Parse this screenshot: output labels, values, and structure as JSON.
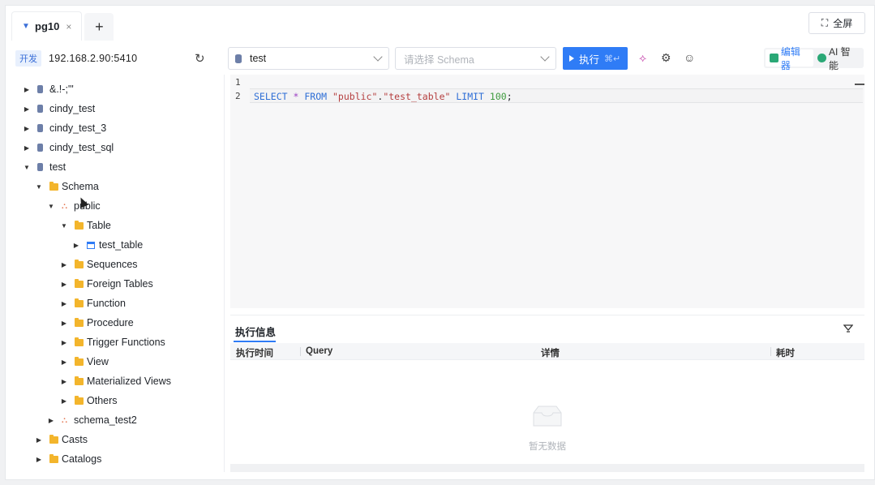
{
  "tabs": [
    {
      "label": "pg10",
      "close": "×"
    }
  ],
  "tab_add": "+",
  "fullscreen_label": "全屏",
  "connection": {
    "env": "开发",
    "host": "192.168.2.90:5410"
  },
  "database_select": {
    "value": "test"
  },
  "schema_select": {
    "placeholder": "请选择 Schema"
  },
  "run_button": {
    "label": "执行",
    "shortcut": "⌘↵"
  },
  "mode": {
    "editor": "编辑器",
    "ai": "AI 智能"
  },
  "tree": {
    "db1": "&.!-;'\"",
    "db2": "cindy_test",
    "db3": "cindy_test_3",
    "db4": "cindy_test_sql",
    "db5": "test",
    "schema_group": "Schema",
    "schema_public": "public",
    "table_group": "Table",
    "table1": "test_table",
    "sequences": "Sequences",
    "foreign_tables": "Foreign Tables",
    "function": "Function",
    "procedure": "Procedure",
    "trigger_functions": "Trigger Functions",
    "view": "View",
    "materialized_views": "Materialized Views",
    "others": "Others",
    "schema_test2": "schema_test2",
    "casts": "Casts",
    "catalogs": "Catalogs"
  },
  "editor": {
    "line_numbers": [
      "1",
      "2"
    ],
    "sql": {
      "kw_select": "SELECT",
      "star": "*",
      "kw_from": "FROM",
      "s_public": "\"public\"",
      "dot": ".",
      "s_table": "\"test_table\"",
      "kw_limit": "LIMIT",
      "num": "100",
      "semi": ";"
    }
  },
  "results": {
    "tab": "执行信息",
    "columns": [
      "执行时间",
      "Query",
      "详情",
      "耗时"
    ],
    "empty": "暂无数据"
  },
  "colors": {
    "accent": "#2f7cf6",
    "folder": "#f3b52c",
    "schema": "#e0683f",
    "db": "#6d7fa8"
  }
}
